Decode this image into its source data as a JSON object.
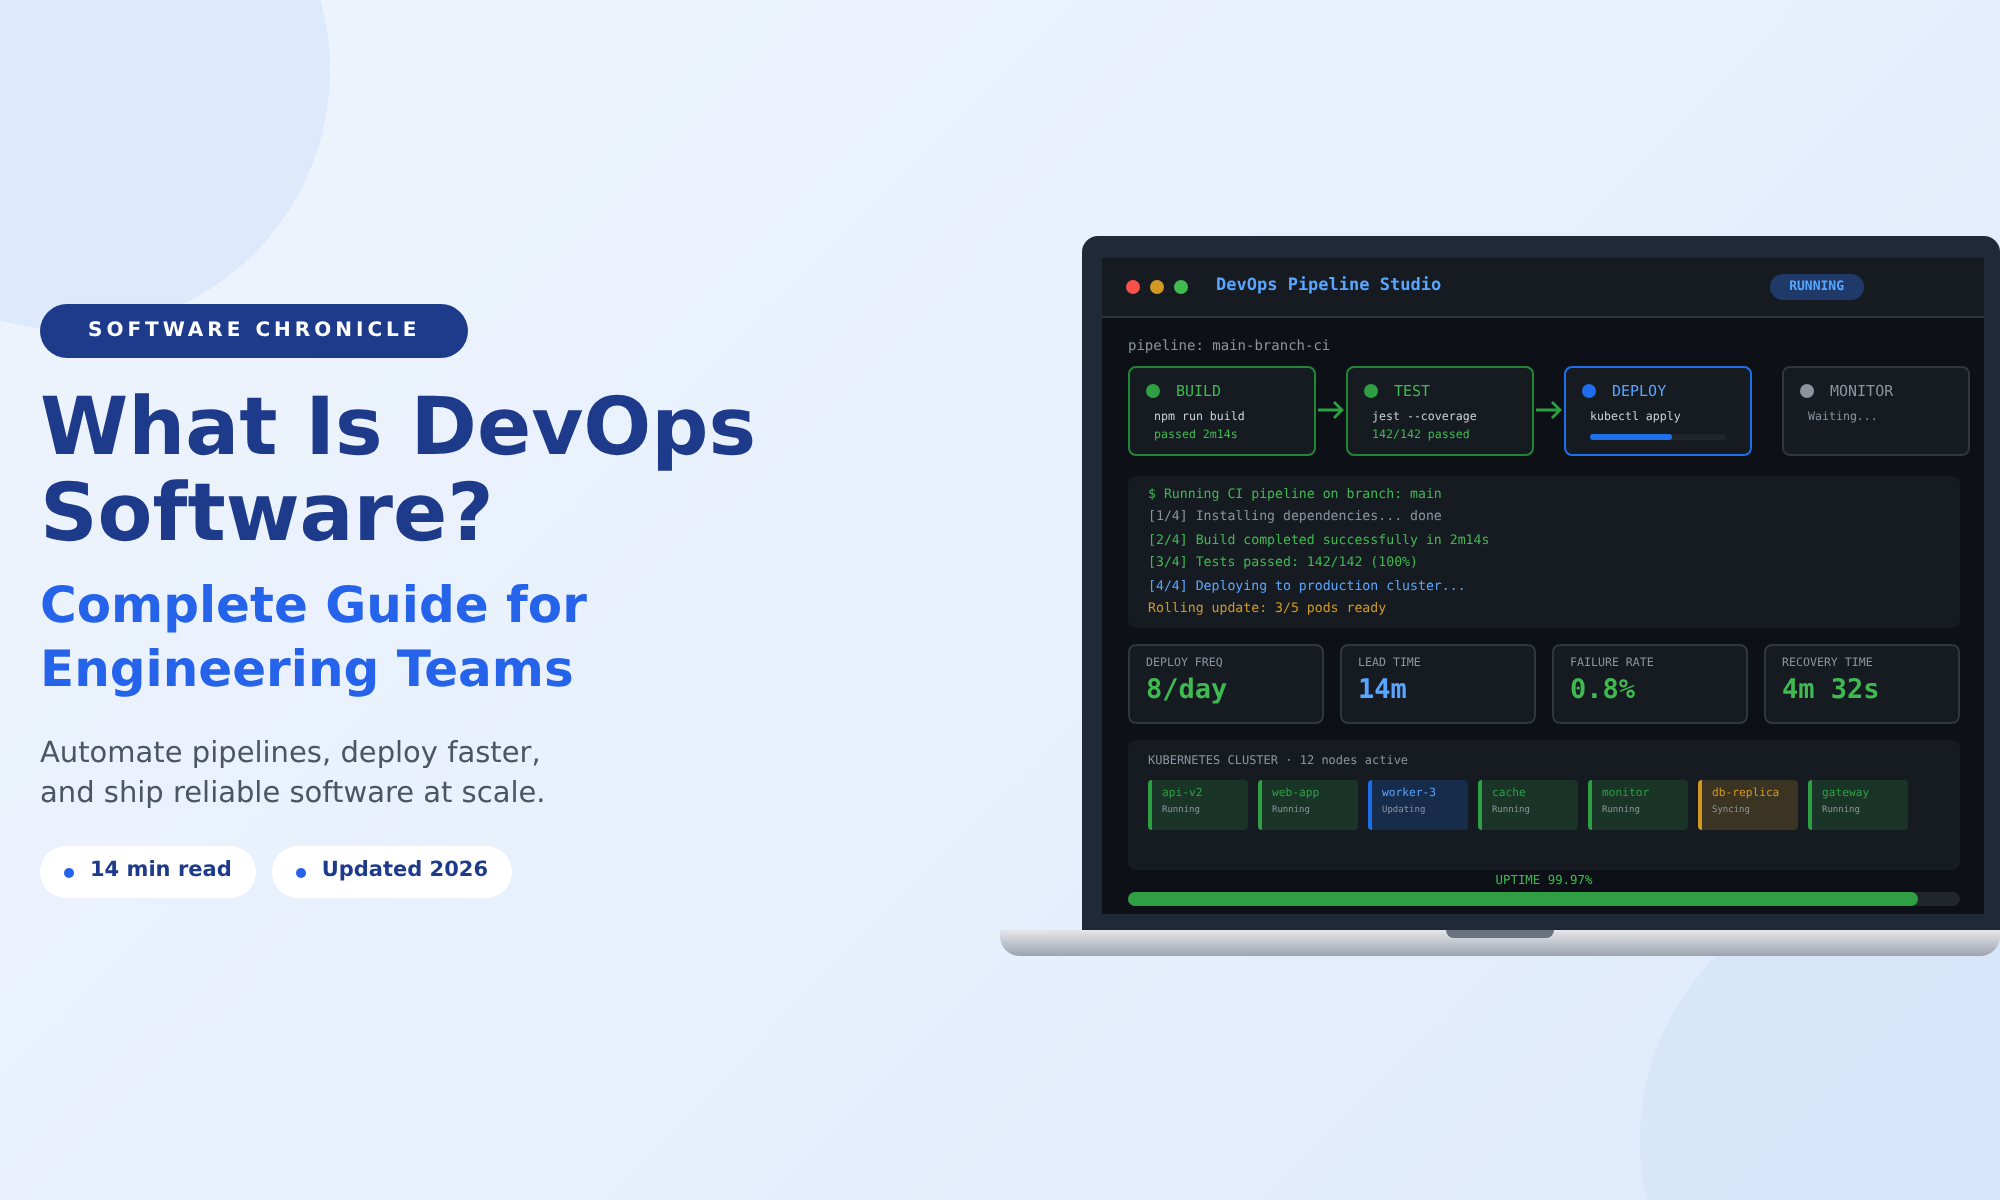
{
  "hero": {
    "badge": "SOFTWARE CHRONICLE",
    "title": "What Is DevOps Software?",
    "subtitle": "Complete Guide for Engineering Teams",
    "description_lines": [
      "Automate pipelines, deploy faster,",
      "and ship reliable software at scale."
    ],
    "meta_pills": [
      {
        "text": "14 min read"
      },
      {
        "text": "Updated 2026"
      }
    ]
  },
  "app": {
    "title": "DevOps Pipeline Studio",
    "status": "RUNNING",
    "pipeline_label": "pipeline: main-branch-ci",
    "stages": [
      {
        "name": "BUILD",
        "kind": "done",
        "command": "npm run build",
        "result": "passed 2m14s"
      },
      {
        "name": "TEST",
        "kind": "done",
        "command": "jest --coverage",
        "result": "142/142 passed"
      },
      {
        "name": "DEPLOY",
        "kind": "active",
        "command": "kubectl apply",
        "level": 0.6
      },
      {
        "name": "MONITOR",
        "kind": "pending",
        "command": "Waiting..."
      }
    ],
    "log": [
      {
        "text": "$ Running CI pipeline on branch: main",
        "kind": "prompt"
      },
      {
        "text": "[1/4] Installing dependencies... done",
        "kind": "info"
      },
      {
        "text": "[2/4] Build completed successfully in 2m14s",
        "kind": "success"
      },
      {
        "text": "[3/4] Tests passed: 142/142 (100%)",
        "kind": "success"
      },
      {
        "text": "[4/4] Deploying to production cluster...",
        "kind": "active"
      },
      {
        "text": "Rolling update: 3/5 pods ready",
        "kind": "warning"
      }
    ],
    "metrics": [
      {
        "label": "DEPLOY FREQ",
        "value": "8/day",
        "color": "#3fb950"
      },
      {
        "label": "LEAD TIME",
        "value": "14m",
        "color": "#58a6ff"
      },
      {
        "label": "FAILURE RATE",
        "value": "0.8%",
        "color": "#3fb950"
      },
      {
        "label": "RECOVERY TIME",
        "value": "4m 32s",
        "color": "#3fb950"
      }
    ],
    "cluster": {
      "title": "KUBERNETES CLUSTER · 12 nodes active",
      "nodes": [
        {
          "name": "api-v2",
          "status": "Running",
          "color": "#2ea043"
        },
        {
          "name": "web-app",
          "status": "Running",
          "color": "#2ea043"
        },
        {
          "name": "worker-3",
          "status": "Updating",
          "color": "#1f6feb"
        },
        {
          "name": "cache",
          "status": "Running",
          "color": "#2ea043"
        },
        {
          "name": "monitor",
          "status": "Running",
          "color": "#2ea043"
        },
        {
          "name": "db-replica",
          "status": "Syncing",
          "color": "#d29922"
        },
        {
          "name": "gateway",
          "status": "Running",
          "color": "#2ea043"
        }
      ]
    },
    "uptime": {
      "label": "UPTIME 99.97%",
      "level": 0.95
    }
  }
}
